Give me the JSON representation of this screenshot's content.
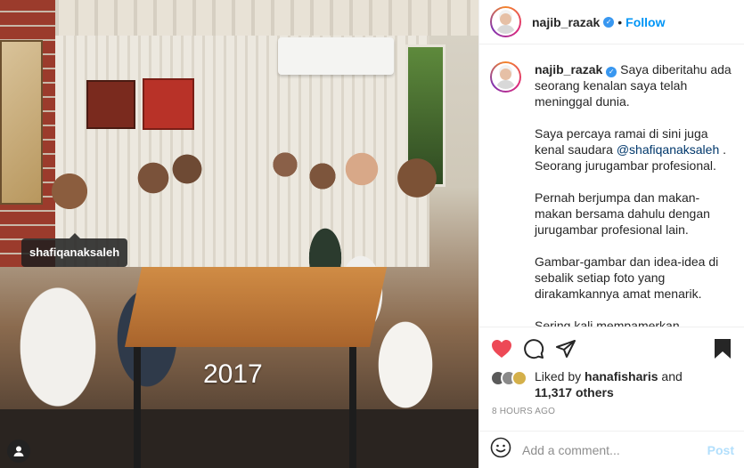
{
  "post": {
    "photo_tag": "shafiqanaksaleh",
    "overlay_year": "2017"
  },
  "header": {
    "username": "najib_razak",
    "verified_mark": "✓",
    "separator": "•",
    "follow_label": "Follow"
  },
  "caption": {
    "username": "najib_razak",
    "paragraphs": [
      "Saya diberitahu ada seorang kenalan saya telah meninggal dunia.",
      "Pernah berjumpa dan makan-makan bersama dahulu dengan jurugambar profesional lain.",
      "Gambar-gambar dan idea-idea di sebalik setiap foto yang dirakamkannya amat menarik.",
      "Sering kali mempamerkan pembangunan Malaysia juga."
    ],
    "p2_before": "Saya percaya ramai di sini juga kenal saudara ",
    "p2_mention": "@shafiqanaksaleh",
    "p2_after": " . Seorang jurugambar profesional."
  },
  "likes": {
    "prefix": "Liked by ",
    "user": "hanafisharis",
    "middle": " and",
    "count": "11,317 others"
  },
  "timestamp": "8 HOURS AGO",
  "comment": {
    "placeholder": "Add a comment...",
    "post_label": "Post"
  },
  "colors": {
    "accent": "#0095f6",
    "heart": "#ed4956",
    "mention": "#00376b"
  },
  "icons": [
    "heart-icon",
    "comment-icon",
    "share-icon",
    "bookmark-icon",
    "emoji-icon",
    "user-tag-icon"
  ]
}
